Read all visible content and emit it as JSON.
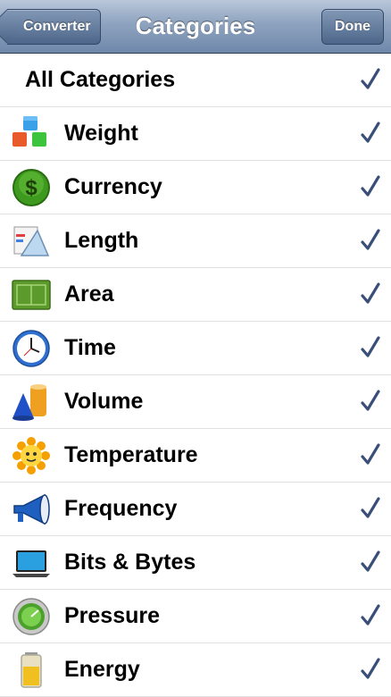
{
  "navbar": {
    "title": "Categories",
    "back_label": "Converter",
    "done_label": "Done"
  },
  "list": {
    "all_label": "All Categories",
    "items": [
      {
        "label": "Weight",
        "icon": "blocks-icon",
        "checked": true
      },
      {
        "label": "Currency",
        "icon": "dollar-coin-icon",
        "checked": true
      },
      {
        "label": "Length",
        "icon": "ruler-tools-icon",
        "checked": true
      },
      {
        "label": "Area",
        "icon": "field-icon",
        "checked": true
      },
      {
        "label": "Time",
        "icon": "clock-icon",
        "checked": true
      },
      {
        "label": "Volume",
        "icon": "cone-cylinder-icon",
        "checked": true
      },
      {
        "label": "Temperature",
        "icon": "sun-icon",
        "checked": true
      },
      {
        "label": "Frequency",
        "icon": "megaphone-icon",
        "checked": true
      },
      {
        "label": "Bits & Bytes",
        "icon": "laptop-icon",
        "checked": true
      },
      {
        "label": "Pressure",
        "icon": "gauge-icon",
        "checked": true
      },
      {
        "label": "Energy",
        "icon": "battery-icon",
        "checked": true
      }
    ]
  },
  "colors": {
    "checkmark": "#3a4f77",
    "navbar_top": "#b9c7da",
    "navbar_bottom": "#6f88aa"
  }
}
